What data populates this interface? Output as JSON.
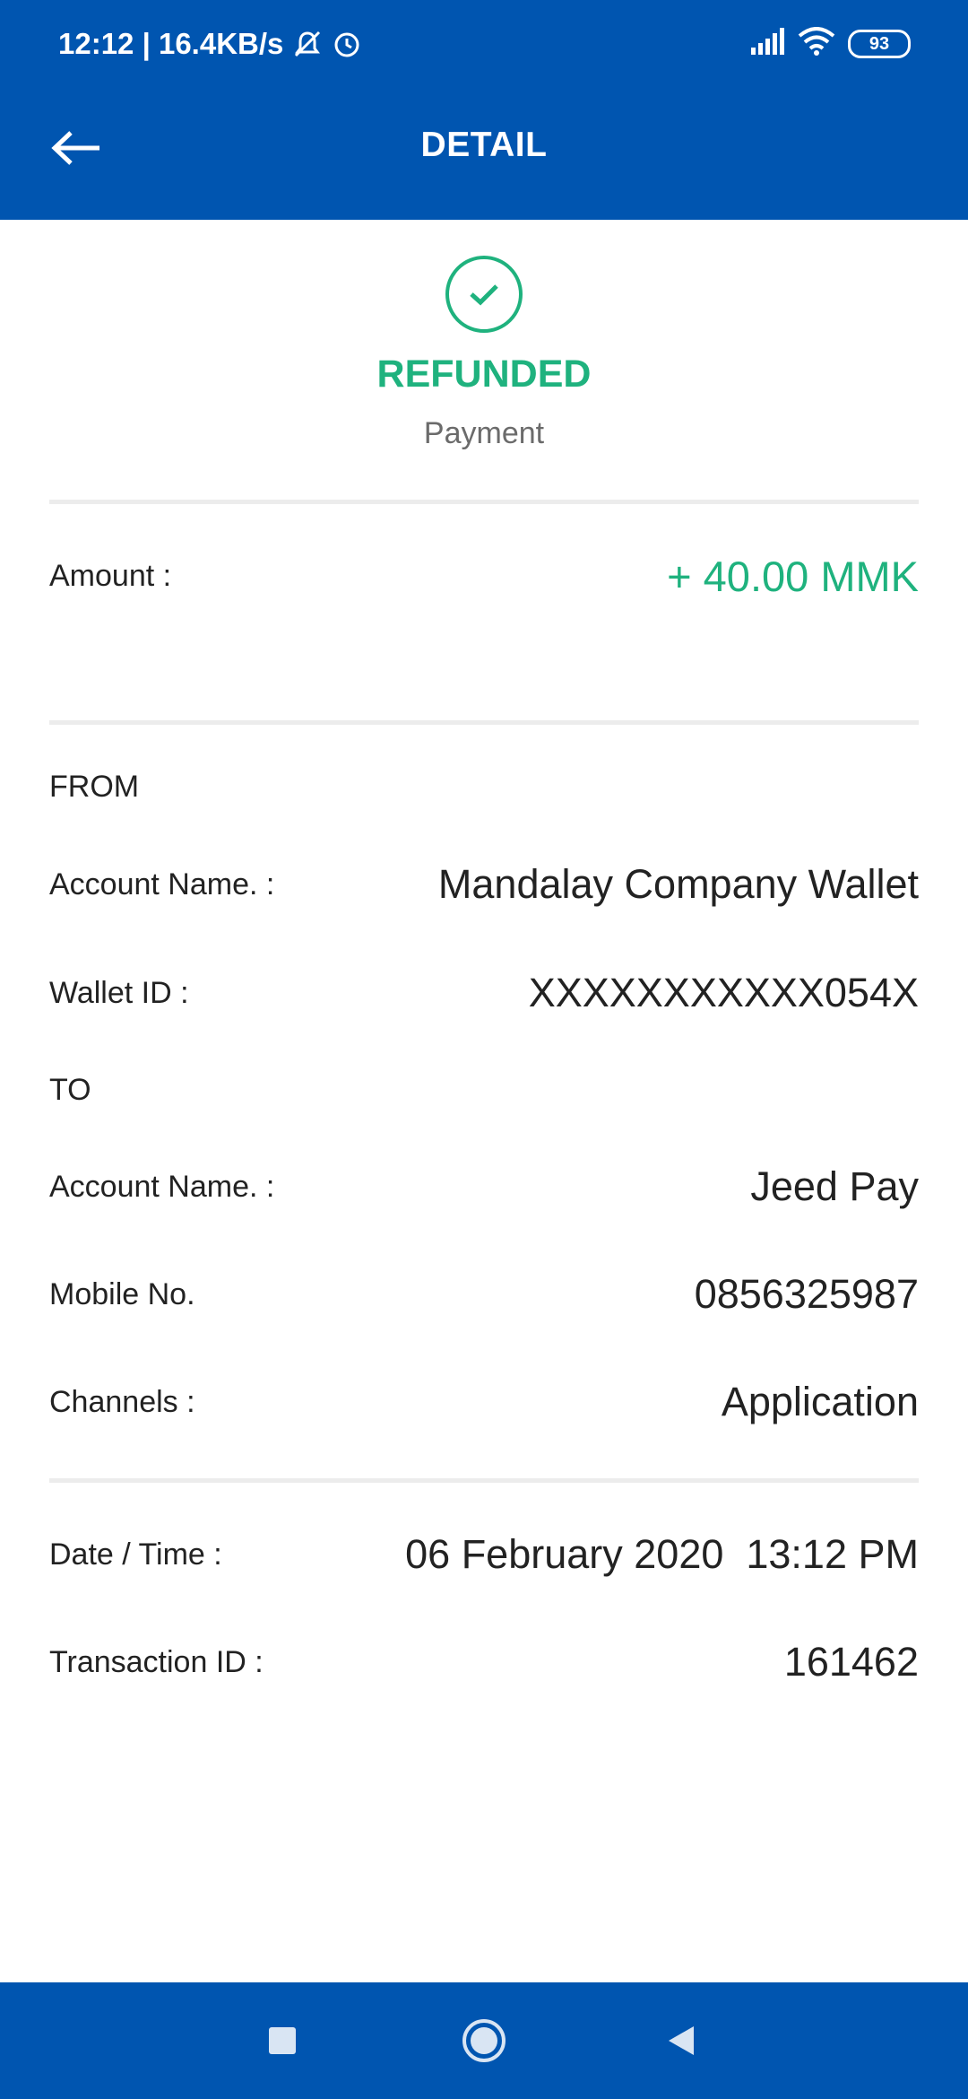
{
  "status_bar": {
    "time_speed": "12:12 | 16.4KB/s",
    "battery": "93",
    "icons": [
      "mute-icon",
      "alarm-icon",
      "signal-icon",
      "wifi-icon",
      "battery-icon"
    ]
  },
  "header": {
    "title": "DETAIL",
    "back_icon": "arrow-left-icon"
  },
  "transaction": {
    "status": "REFUNDED",
    "type": "Payment",
    "status_color": "#1fb27e",
    "amount_label": "Amount :",
    "amount_value": "+ 40.00 MMK"
  },
  "from": {
    "heading": "FROM",
    "account_name_label": "Account Name. :",
    "account_name_value": "Mandalay Company Wallet",
    "wallet_id_label": "Wallet ID :",
    "wallet_id_value": "XXXXXXXXXXX054X"
  },
  "to": {
    "heading": "TO",
    "account_name_label": "Account Name. :",
    "account_name_value": "Jeed Pay",
    "mobile_label": "Mobile No.",
    "mobile_value": "0856325987",
    "channels_label": "Channels :",
    "channels_value": "Application"
  },
  "meta": {
    "datetime_label": "Date / Time :",
    "datetime_value": "06 February 2020  13:12 PM",
    "txn_id_label": "Transaction ID :",
    "txn_id_value": "161462"
  },
  "colors": {
    "brand_blue": "#0055b0",
    "success_green": "#1fb27e"
  },
  "nav_bar": {
    "buttons": [
      "recent-apps-icon",
      "home-icon",
      "back-triangle-icon"
    ]
  }
}
